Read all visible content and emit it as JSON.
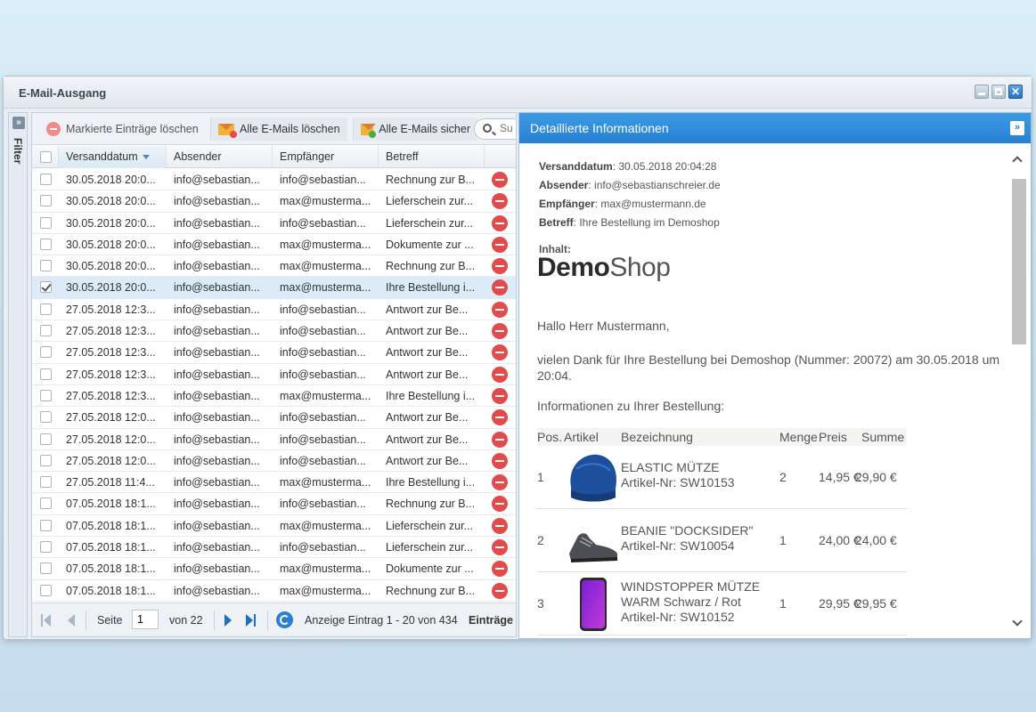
{
  "window": {
    "title": "E-Mail-Ausgang"
  },
  "filter": {
    "label": "Filter",
    "expand_glyph": "»"
  },
  "toolbar": {
    "delete_marked": "Markierte Einträge löschen",
    "delete_all": "Alle E-Mails löschen",
    "save_all": "Alle E-Mails sicher",
    "search_placeholder": "Su"
  },
  "grid": {
    "columns": [
      "Versanddatum",
      "Absender",
      "Empfänger",
      "Betreff"
    ],
    "rows": [
      {
        "date": "30.05.2018 20:0...",
        "from": "info@sebastian...",
        "to": "info@sebastian...",
        "subject": "Rechnung zur B...",
        "checked": false
      },
      {
        "date": "30.05.2018 20:0...",
        "from": "info@sebastian...",
        "to": "max@musterma...",
        "subject": "Lieferschein zur...",
        "checked": false
      },
      {
        "date": "30.05.2018 20:0...",
        "from": "info@sebastian...",
        "to": "info@sebastian...",
        "subject": "Lieferschein zur...",
        "checked": false
      },
      {
        "date": "30.05.2018 20:0...",
        "from": "info@sebastian...",
        "to": "max@musterma...",
        "subject": "Dokumente zur ...",
        "checked": false
      },
      {
        "date": "30.05.2018 20:0...",
        "from": "info@sebastian...",
        "to": "max@musterma...",
        "subject": "Rechnung zur B...",
        "checked": false
      },
      {
        "date": "30.05.2018 20:0...",
        "from": "info@sebastian...",
        "to": "max@musterma...",
        "subject": "Ihre Bestellung i...",
        "checked": true
      },
      {
        "date": "27.05.2018 12:3...",
        "from": "info@sebastian...",
        "to": "info@sebastian...",
        "subject": "Antwort zur Be...",
        "checked": false
      },
      {
        "date": "27.05.2018 12:3...",
        "from": "info@sebastian...",
        "to": "info@sebastian...",
        "subject": "Antwort zur Be...",
        "checked": false
      },
      {
        "date": "27.05.2018 12:3...",
        "from": "info@sebastian...",
        "to": "info@sebastian...",
        "subject": "Antwort zur Be...",
        "checked": false
      },
      {
        "date": "27.05.2018 12:3...",
        "from": "info@sebastian...",
        "to": "info@sebastian...",
        "subject": "Antwort zur Be...",
        "checked": false
      },
      {
        "date": "27.05.2018 12:3...",
        "from": "info@sebastian...",
        "to": "max@musterma...",
        "subject": "Ihre Bestellung i...",
        "checked": false
      },
      {
        "date": "27.05.2018 12:0...",
        "from": "info@sebastian...",
        "to": "info@sebastian...",
        "subject": "Antwort zur Be...",
        "checked": false
      },
      {
        "date": "27.05.2018 12:0...",
        "from": "info@sebastian...",
        "to": "info@sebastian...",
        "subject": "Antwort zur Be...",
        "checked": false
      },
      {
        "date": "27.05.2018 12:0...",
        "from": "info@sebastian...",
        "to": "info@sebastian...",
        "subject": "Antwort zur Be...",
        "checked": false
      },
      {
        "date": "27.05.2018 11:4...",
        "from": "info@sebastian...",
        "to": "max@musterma...",
        "subject": "Ihre Bestellung i...",
        "checked": false
      },
      {
        "date": "07.05.2018 18:1...",
        "from": "info@sebastian...",
        "to": "info@sebastian...",
        "subject": "Rechnung zur B...",
        "checked": false
      },
      {
        "date": "07.05.2018 18:1...",
        "from": "info@sebastian...",
        "to": "max@musterma...",
        "subject": "Lieferschein zur...",
        "checked": false
      },
      {
        "date": "07.05.2018 18:1...",
        "from": "info@sebastian...",
        "to": "info@sebastian...",
        "subject": "Lieferschein zur...",
        "checked": false
      },
      {
        "date": "07.05.2018 18:1...",
        "from": "info@sebastian...",
        "to": "max@musterma...",
        "subject": "Dokumente zur ...",
        "checked": false
      },
      {
        "date": "07.05.2018 18:1...",
        "from": "info@sebastian...",
        "to": "max@musterma...",
        "subject": "Rechnung zur B...",
        "checked": false
      }
    ]
  },
  "pager": {
    "page_label": "Seite",
    "page_value": "1",
    "of_label": "von 22",
    "display": "Anzeige Eintrag 1 - 20 von 434",
    "entries": "Einträge"
  },
  "detail": {
    "title": "Detaillierte Informationen",
    "collapse_glyph": "»",
    "meta": {
      "date_label": "Versanddatum",
      "date_value": "30.05.2018 20:04:28",
      "from_label": "Absender",
      "from_value": "info@sebastianschreier.de",
      "to_label": "Empfänger",
      "to_value": "max@mustermann.de",
      "subject_label": "Betreff",
      "subject_value": "Ihre Bestellung im Demoshop"
    },
    "content_label": "Inhalt:",
    "logo_demo": "Demo",
    "logo_shop": "Shop",
    "greeting": "Hallo Herr Mustermann,",
    "thanks": "vielen Dank für Ihre Bestellung bei Demoshop (Nummer: 20072) am 30.05.2018 um 20:04.",
    "info_heading": "Informationen zu Ihrer Bestellung:",
    "order_columns": {
      "pos": "Pos.",
      "article": "Artikel",
      "desc": "Bezeichnung",
      "qty": "Menge",
      "price": "Preis",
      "sum": "Summe"
    },
    "order_items": [
      {
        "pos": "1",
        "name": "ELASTIC MÜTZE",
        "sku": "Artikel-Nr: SW10153",
        "qty": "2",
        "price": "14,95 €",
        "sum": "29,90 €",
        "image": "beanie-icon"
      },
      {
        "pos": "2",
        "name": "BEANIE \"DOCKSIDER\"",
        "sku": "Artikel-Nr: SW10054",
        "qty": "1",
        "price": "24,00 €",
        "sum": "24,00 €",
        "image": "sneaker-icon"
      },
      {
        "pos": "3",
        "name": "WINDSTOPPER MÜTZE",
        "name2": "WARM Schwarz / Rot",
        "sku": "Artikel-Nr: SW10152",
        "qty": "1",
        "price": "29,95 €",
        "sum": "29,95 €",
        "image": "smartphone-icon"
      }
    ]
  }
}
